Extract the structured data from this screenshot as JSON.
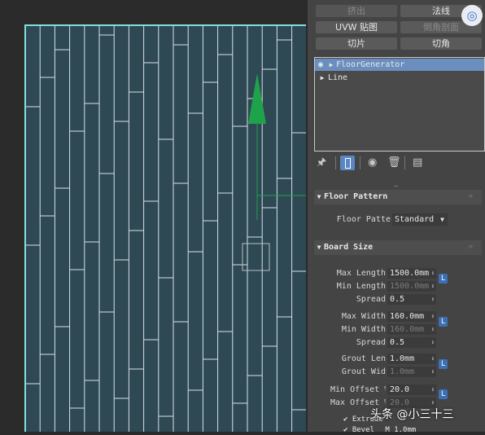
{
  "toolbar": {
    "buttons": [
      {
        "label": "挤出",
        "enabled": false
      },
      {
        "label": "法线",
        "enabled": true
      },
      {
        "label": "UVW 贴图",
        "enabled": true
      },
      {
        "label": "倒角剖面",
        "enabled": false
      },
      {
        "label": "切片",
        "enabled": true
      },
      {
        "label": "切角",
        "enabled": true
      }
    ]
  },
  "modifier_stack": {
    "items": [
      {
        "label": "FloorGenerator",
        "selected": true,
        "visible_eye": true
      },
      {
        "label": "Line",
        "selected": false,
        "visible_eye": false
      }
    ]
  },
  "stack_tools": [
    "pin-icon",
    "show-end-result-icon",
    "make-unique-icon",
    "remove-modifier-icon",
    "configure-sets-icon"
  ],
  "floor_pattern": {
    "title": "Floor Pattern",
    "pattern_label": "Floor Patte",
    "pattern_value": "Standard"
  },
  "board_size": {
    "title": "Board Size",
    "rows": [
      {
        "label": "Max Length",
        "value": "1500.0mm",
        "enabled": true
      },
      {
        "label": "Min Length",
        "value": "1500.0mm",
        "enabled": false
      },
      {
        "label": "Spread",
        "value": "0.5",
        "enabled": true
      },
      {
        "label": "Max Width",
        "value": "160.0mm",
        "enabled": true
      },
      {
        "label": "Min Width",
        "value": "160.0mm",
        "enabled": false
      },
      {
        "label": "Spread",
        "value": "0.5",
        "enabled": true
      },
      {
        "label": "Grout Len",
        "value": "1.0mm",
        "enabled": true
      },
      {
        "label": "Grout Wid",
        "value": "1.0mm",
        "enabled": false
      },
      {
        "label": "Min Offset %",
        "value": "20.0",
        "enabled": true
      },
      {
        "label": "Max Offset %",
        "value": "20.0",
        "enabled": false
      }
    ],
    "lock_label": "L",
    "checkboxes": [
      {
        "label": "Extrude",
        "checked": true
      },
      {
        "label": "Bevel",
        "checked": true,
        "suffix": "M",
        "value": "1.0mm"
      }
    ]
  },
  "watermark": "头条 @小三十三",
  "colors": {
    "board_fill": "#2e4854",
    "grout": "#d8e2e6",
    "boundary": "#7fe0e0",
    "gizmo": "#1fa34a",
    "accent": "#6a8fbf"
  }
}
